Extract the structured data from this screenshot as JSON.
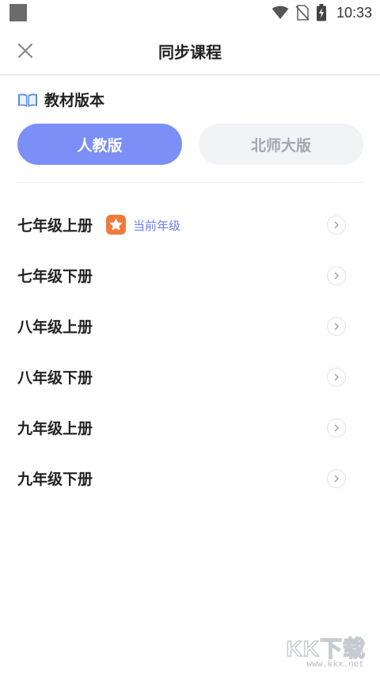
{
  "status_bar": {
    "time": "10:33"
  },
  "nav": {
    "title": "同步课程"
  },
  "section": {
    "title": "教材版本"
  },
  "tabs": [
    {
      "label": "人教版",
      "active": true
    },
    {
      "label": "北师大版",
      "active": false
    }
  ],
  "grades": [
    {
      "label": "七年级上册",
      "current": true,
      "current_tag": "当前年级"
    },
    {
      "label": "七年级下册",
      "current": false
    },
    {
      "label": "八年级上册",
      "current": false
    },
    {
      "label": "八年级下册",
      "current": false
    },
    {
      "label": "九年级上册",
      "current": false
    },
    {
      "label": "九年级下册",
      "current": false
    }
  ],
  "watermark": {
    "main": "KK下载",
    "sub": "www.kkx.net"
  },
  "colors": {
    "accent": "#7b8ff7",
    "tag_text": "#6f81ef",
    "badge": "#f07a3a",
    "inactive_tab": "#f2f3f5"
  }
}
